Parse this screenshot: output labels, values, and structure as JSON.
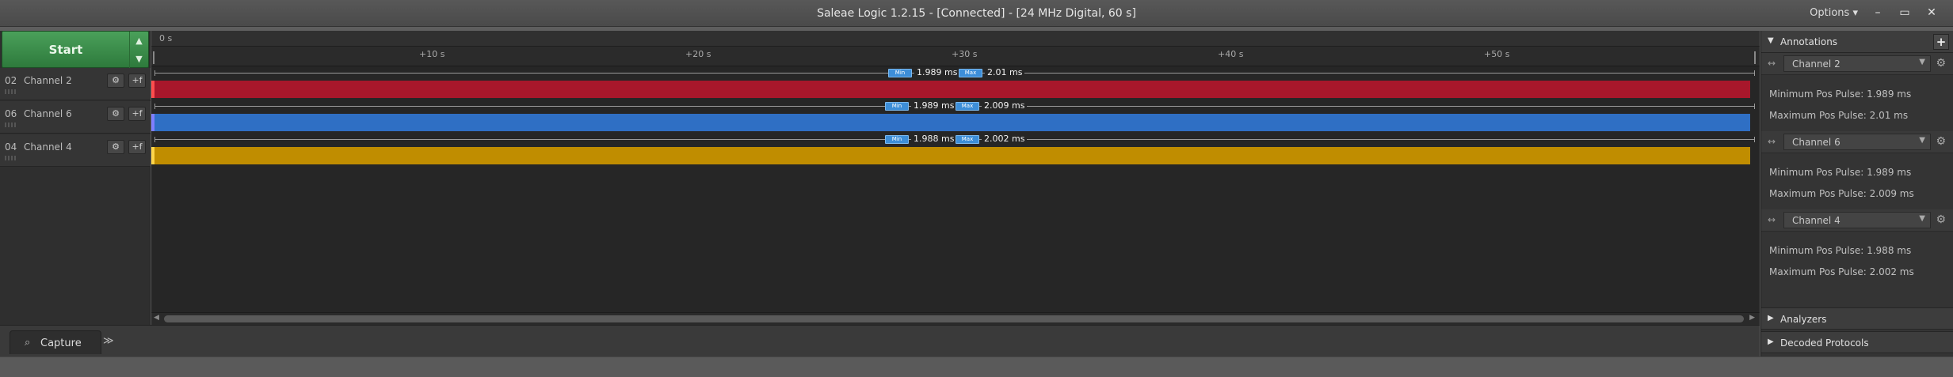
{
  "window": {
    "title": "Saleae Logic 1.2.15 - [Connected] - [24 MHz Digital, 60 s]",
    "options_label": "Options",
    "options_chevron": "▾",
    "minimize": "–",
    "maximize": "▭",
    "close": "✕"
  },
  "start": {
    "label": "Start",
    "up": "▲",
    "down": "▼"
  },
  "channels": [
    {
      "num": "02",
      "name": "Channel 2",
      "color": "#a8172b",
      "edge": "#ff4d4d"
    },
    {
      "num": "06",
      "name": "Channel 6",
      "color": "#2f6fc4",
      "edge": "#7f7fff"
    },
    {
      "num": "04",
      "name": "Channel 4",
      "color": "#c08d00",
      "edge": "#ffd54a"
    }
  ],
  "channel_buttons": {
    "settings": "⚙",
    "trigger": "+f"
  },
  "ruler": {
    "zero": "0 s",
    "ticks": [
      "+10 s",
      "+20 s",
      "+30 s",
      "+40 s",
      "+50 s"
    ]
  },
  "measurements": [
    {
      "min_badge": "Min",
      "min": "1.989 ms",
      "max_badge": "Max",
      "max": "2.01 ms"
    },
    {
      "min_badge": "Min",
      "min": "1.989 ms",
      "max_badge": "Max",
      "max": "2.009 ms"
    },
    {
      "min_badge": "Min",
      "min": "1.988 ms",
      "max_badge": "Max",
      "max": "2.002 ms"
    }
  ],
  "scroll": {
    "left": "◀",
    "right": "▶"
  },
  "bottom": {
    "capture_label": "Capture",
    "capture_icon": "⌕",
    "more": "≫"
  },
  "panel": {
    "annotations_title": "Annotations",
    "add": "+",
    "expanded": "▼",
    "collapsed": "▶",
    "analyzers_title": "Analyzers",
    "decoded_title": "Decoded Protocols",
    "ann_arrow": "↔",
    "ann_chevron": "▼",
    "ann_gear": "⚙",
    "annotations": [
      {
        "channel": "Channel 2",
        "min_text": "Minimum Pos Pulse: 1.989 ms",
        "max_text": "Maximum Pos Pulse: 2.01 ms"
      },
      {
        "channel": "Channel 6",
        "min_text": "Minimum Pos Pulse: 1.989 ms",
        "max_text": "Maximum Pos Pulse: 2.009 ms"
      },
      {
        "channel": "Channel 4",
        "min_text": "Minimum Pos Pulse: 1.988 ms",
        "max_text": "Maximum Pos Pulse: 2.002 ms"
      }
    ]
  },
  "colors": {
    "start_green": "#3a8f48",
    "badge_blue": "#3d8ed8"
  }
}
